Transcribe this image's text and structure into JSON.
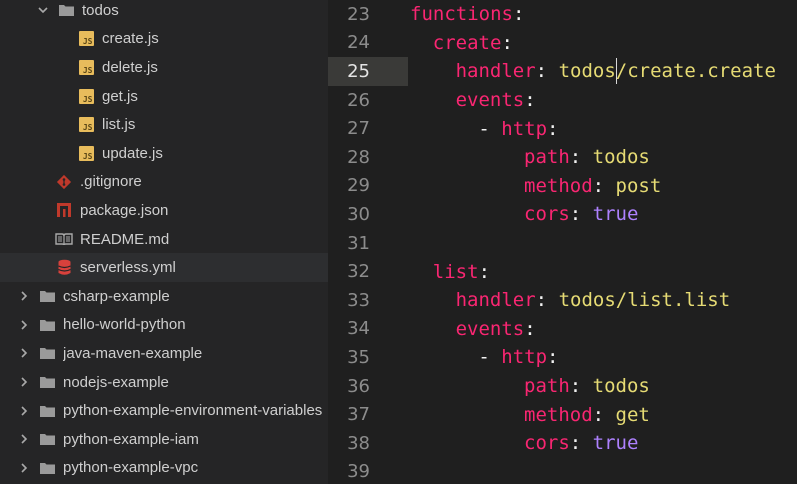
{
  "tree": [
    {
      "kind": "folder",
      "label": "todos",
      "depth": 1,
      "expanded": true
    },
    {
      "kind": "js",
      "label": "create.js",
      "depth": 2
    },
    {
      "kind": "js",
      "label": "delete.js",
      "depth": 2
    },
    {
      "kind": "js",
      "label": "get.js",
      "depth": 2
    },
    {
      "kind": "js",
      "label": "list.js",
      "depth": 2
    },
    {
      "kind": "js",
      "label": "update.js",
      "depth": 2
    },
    {
      "kind": "git",
      "label": ".gitignore",
      "depth": 1
    },
    {
      "kind": "npm",
      "label": "package.json",
      "depth": 1
    },
    {
      "kind": "book",
      "label": "README.md",
      "depth": 1
    },
    {
      "kind": "db",
      "label": "serverless.yml",
      "depth": 1,
      "selected": true
    },
    {
      "kind": "folder",
      "label": "csharp-example",
      "depth": 0,
      "expanded": false
    },
    {
      "kind": "folder",
      "label": "hello-world-python",
      "depth": 0,
      "expanded": false
    },
    {
      "kind": "folder",
      "label": "java-maven-example",
      "depth": 0,
      "expanded": false
    },
    {
      "kind": "folder",
      "label": "nodejs-example",
      "depth": 0,
      "expanded": false
    },
    {
      "kind": "folder",
      "label": "python-example-environment-variables",
      "depth": 0,
      "expanded": false
    },
    {
      "kind": "folder",
      "label": "python-example-iam",
      "depth": 0,
      "expanded": false
    },
    {
      "kind": "folder",
      "label": "python-example-vpc",
      "depth": 0,
      "expanded": false
    }
  ],
  "js_badge": "JS",
  "editor": {
    "current_line": 25,
    "lines": [
      {
        "n": 23,
        "indent": 0,
        "key": "functions",
        "sep": ":",
        "val": "",
        "val_type": ""
      },
      {
        "n": 24,
        "indent": 1,
        "key": "create",
        "sep": ":",
        "val": "",
        "val_type": ""
      },
      {
        "n": 25,
        "indent": 2,
        "key": "handler",
        "sep": ": ",
        "val": "todos/create.create",
        "val_type": "str"
      },
      {
        "n": 26,
        "indent": 2,
        "key": "events",
        "sep": ":",
        "val": "",
        "val_type": ""
      },
      {
        "n": 27,
        "indent": 3,
        "dash": "- ",
        "key": "http",
        "sep": ":",
        "val": "",
        "val_type": ""
      },
      {
        "n": 28,
        "indent": 5,
        "key": "path",
        "sep": ": ",
        "val": "todos",
        "val_type": "str"
      },
      {
        "n": 29,
        "indent": 5,
        "key": "method",
        "sep": ": ",
        "val": "post",
        "val_type": "str"
      },
      {
        "n": 30,
        "indent": 5,
        "key": "cors",
        "sep": ": ",
        "val": "true",
        "val_type": "bool"
      },
      {
        "n": 31,
        "indent": 0,
        "key": "",
        "sep": "",
        "val": "",
        "val_type": ""
      },
      {
        "n": 32,
        "indent": 1,
        "key": "list",
        "sep": ":",
        "val": "",
        "val_type": ""
      },
      {
        "n": 33,
        "indent": 2,
        "key": "handler",
        "sep": ": ",
        "val": "todos/list.list",
        "val_type": "str"
      },
      {
        "n": 34,
        "indent": 2,
        "key": "events",
        "sep": ":",
        "val": "",
        "val_type": ""
      },
      {
        "n": 35,
        "indent": 3,
        "dash": "- ",
        "key": "http",
        "sep": ":",
        "val": "",
        "val_type": ""
      },
      {
        "n": 36,
        "indent": 5,
        "key": "path",
        "sep": ": ",
        "val": "todos",
        "val_type": "str"
      },
      {
        "n": 37,
        "indent": 5,
        "key": "method",
        "sep": ": ",
        "val": "get",
        "val_type": "str"
      },
      {
        "n": 38,
        "indent": 5,
        "key": "cors",
        "sep": ": ",
        "val": "true",
        "val_type": "bool"
      },
      {
        "n": 39,
        "indent": 0,
        "key": "",
        "sep": "",
        "val": "",
        "val_type": ""
      }
    ]
  },
  "colors": {
    "key": "#f92672",
    "string": "#e6db74",
    "bool": "#ae81ff",
    "js_icon": "#e8bc5c",
    "git_icon": "#c0392b",
    "npm_icon": "#c0392b",
    "db_icon": "#d8413c",
    "folder_icon": "#9a9a9a"
  }
}
